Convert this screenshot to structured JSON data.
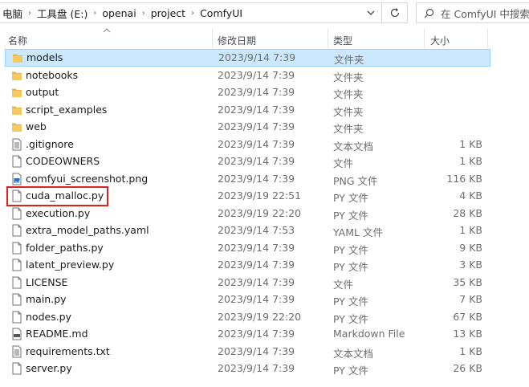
{
  "address": {
    "crumbs": [
      "电脑",
      "工具盘 (E:)",
      "openai",
      "project",
      "ComfyUI"
    ]
  },
  "search": {
    "placeholder": "在 ComfyUI 中搜索"
  },
  "columns": {
    "name": "名称",
    "date": "修改日期",
    "type": "类型",
    "size": "大小"
  },
  "colors": {
    "selected_bg": "#cce8ff",
    "selected_border": "#99d1ff",
    "folder": "#e8b64c",
    "highlight": "#e0201f"
  },
  "files": [
    {
      "name": "models",
      "date": "2023/9/14 7:39",
      "type": "文件夹",
      "size": "",
      "icon": "folder-icon",
      "selected": true
    },
    {
      "name": "notebooks",
      "date": "2023/9/14 7:39",
      "type": "文件夹",
      "size": "",
      "icon": "folder-icon"
    },
    {
      "name": "output",
      "date": "2023/9/14 7:39",
      "type": "文件夹",
      "size": "",
      "icon": "folder-icon"
    },
    {
      "name": "script_examples",
      "date": "2023/9/14 7:39",
      "type": "文件夹",
      "size": "",
      "icon": "folder-icon"
    },
    {
      "name": "web",
      "date": "2023/9/14 7:39",
      "type": "文件夹",
      "size": "",
      "icon": "folder-icon"
    },
    {
      "name": ".gitignore",
      "date": "2023/9/14 7:39",
      "type": "文本文档",
      "size": "1 KB",
      "icon": "text-file-icon"
    },
    {
      "name": "CODEOWNERS",
      "date": "2023/9/14 7:39",
      "type": "文件",
      "size": "1 KB",
      "icon": "blank-file-icon"
    },
    {
      "name": "comfyui_screenshot.png",
      "date": "2023/9/14 7:39",
      "type": "PNG 文件",
      "size": "116 KB",
      "icon": "image-file-icon"
    },
    {
      "name": "cuda_malloc.py",
      "date": "2023/9/19 22:51",
      "type": "PY 文件",
      "size": "4 KB",
      "icon": "blank-file-icon"
    },
    {
      "name": "execution.py",
      "date": "2023/9/19 22:20",
      "type": "PY 文件",
      "size": "28 KB",
      "icon": "blank-file-icon"
    },
    {
      "name": "extra_model_paths.yaml",
      "date": "2023/9/14 7:53",
      "type": "YAML 文件",
      "size": "1 KB",
      "icon": "blank-file-icon"
    },
    {
      "name": "folder_paths.py",
      "date": "2023/9/14 7:39",
      "type": "PY 文件",
      "size": "9 KB",
      "icon": "blank-file-icon"
    },
    {
      "name": "latent_preview.py",
      "date": "2023/9/14 7:39",
      "type": "PY 文件",
      "size": "3 KB",
      "icon": "blank-file-icon"
    },
    {
      "name": "LICENSE",
      "date": "2023/9/14 7:39",
      "type": "文件",
      "size": "35 KB",
      "icon": "blank-file-icon"
    },
    {
      "name": "main.py",
      "date": "2023/9/14 7:39",
      "type": "PY 文件",
      "size": "7 KB",
      "icon": "blank-file-icon"
    },
    {
      "name": "nodes.py",
      "date": "2023/9/19 22:20",
      "type": "PY 文件",
      "size": "67 KB",
      "icon": "blank-file-icon"
    },
    {
      "name": "README.md",
      "date": "2023/9/14 7:39",
      "type": "Markdown File",
      "size": "13 KB",
      "icon": "markdown-file-icon"
    },
    {
      "name": "requirements.txt",
      "date": "2023/9/14 7:39",
      "type": "文本文档",
      "size": "1 KB",
      "icon": "text-file-icon"
    },
    {
      "name": "server.py",
      "date": "2023/9/14 7:39",
      "type": "PY 文件",
      "size": "26 KB",
      "icon": "blank-file-icon"
    }
  ]
}
